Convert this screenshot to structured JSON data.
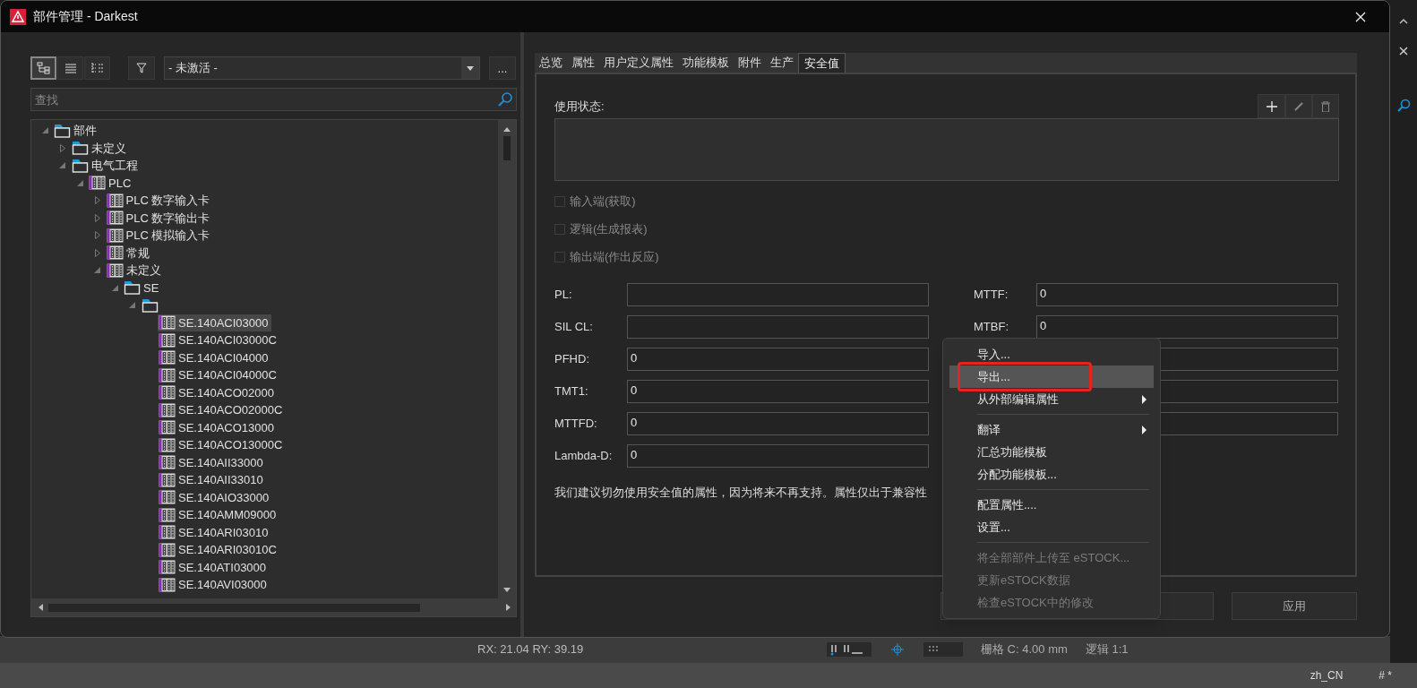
{
  "window": {
    "title": "部件管理 - Darkest"
  },
  "left_toolbar": {
    "view_buttons": [
      {
        "kind": "tree",
        "selected": true
      },
      {
        "kind": "list",
        "selected": false
      },
      {
        "kind": "tree_list",
        "selected": false
      }
    ],
    "filter_value": "- 未激活 -",
    "more_button": "..."
  },
  "search": {
    "placeholder": "查找"
  },
  "tree": [
    {
      "kind": "folder",
      "name": "部件",
      "expanded": true,
      "selected": false,
      "children": [
        {
          "kind": "folder",
          "name": "未定义",
          "expanded": false,
          "selected": false
        },
        {
          "kind": "folder",
          "name": "电气工程",
          "expanded": true,
          "selected": false,
          "children": [
            {
              "kind": "component",
              "name": "PLC",
              "expanded": true,
              "selected": false,
              "children": [
                {
                  "kind": "component",
                  "name": "PLC 数字输入卡",
                  "expanded": false,
                  "selected": false
                },
                {
                  "kind": "component",
                  "name": "PLC 数字输出卡",
                  "expanded": false,
                  "selected": false
                },
                {
                  "kind": "component",
                  "name": "PLC 模拟输入卡",
                  "expanded": false,
                  "selected": false
                },
                {
                  "kind": "component",
                  "name": "常规",
                  "expanded": false,
                  "selected": false
                },
                {
                  "kind": "component",
                  "name": "未定义",
                  "expanded": true,
                  "selected": false,
                  "children": [
                    {
                      "kind": "folder",
                      "name": "SE",
                      "expanded": true,
                      "selected": false,
                      "children": [
                        {
                          "kind": "folder",
                          "expanded": true,
                          "selected": false,
                          "children": [
                            {
                              "kind": "component",
                              "name": "SE.140ACI03000",
                              "selected": true
                            },
                            {
                              "kind": "component",
                              "name": "SE.140ACI03000C",
                              "selected": false
                            },
                            {
                              "kind": "component",
                              "name": "SE.140ACI04000",
                              "selected": false
                            },
                            {
                              "kind": "component",
                              "name": "SE.140ACI04000C",
                              "selected": false
                            },
                            {
                              "kind": "component",
                              "name": "SE.140ACO02000",
                              "selected": false
                            },
                            {
                              "kind": "component",
                              "name": "SE.140ACO02000C",
                              "selected": false
                            },
                            {
                              "kind": "component",
                              "name": "SE.140ACO13000",
                              "selected": false
                            },
                            {
                              "kind": "component",
                              "name": "SE.140ACO13000C",
                              "selected": false
                            },
                            {
                              "kind": "component",
                              "name": "SE.140AII33000",
                              "selected": false
                            },
                            {
                              "kind": "component",
                              "name": "SE.140AII33010",
                              "selected": false
                            },
                            {
                              "kind": "component",
                              "name": "SE.140AIO33000",
                              "selected": false
                            },
                            {
                              "kind": "component",
                              "name": "SE.140AMM09000",
                              "selected": false
                            },
                            {
                              "kind": "component",
                              "name": "SE.140ARI03010",
                              "selected": false
                            },
                            {
                              "kind": "component",
                              "name": "SE.140ARI03010C",
                              "selected": false
                            },
                            {
                              "kind": "component",
                              "name": "SE.140ATI03000",
                              "selected": false
                            },
                            {
                              "kind": "component",
                              "name": "SE.140AVI03000",
                              "selected": false
                            }
                          ]
                        }
                      ]
                    }
                  ]
                }
              ]
            }
          ]
        }
      ]
    }
  ],
  "tabs": [
    {
      "label": "总览",
      "selected": false
    },
    {
      "label": "属性",
      "selected": false
    },
    {
      "label": "用户定义属性",
      "selected": false
    },
    {
      "label": "功能模板",
      "selected": false
    },
    {
      "label": "附件",
      "selected": false
    },
    {
      "label": "生产",
      "selected": false
    },
    {
      "label": "安全值",
      "selected": true
    }
  ],
  "usage_status": {
    "label": "使用状态:"
  },
  "checkboxes": [
    {
      "label": "输入端(获取)",
      "checked": false,
      "disabled": true
    },
    {
      "label": "逻辑(生成报表)",
      "checked": false,
      "disabled": true
    },
    {
      "label": "输出端(作出反应)",
      "checked": false,
      "disabled": true
    }
  ],
  "fields_left": [
    {
      "label": "PL:"
    },
    {
      "label": "SIL CL:"
    },
    {
      "label": "PFHD:",
      "value": "0"
    },
    {
      "label": "TMT1:",
      "value": "0"
    },
    {
      "label": "MTTFD:",
      "value": "0"
    },
    {
      "label": "Lambda-D:",
      "value": "0"
    }
  ],
  "fields_right": [
    {
      "kind": "field",
      "label": "MTTF:",
      "value": "0"
    },
    {
      "kind": "field",
      "label": "MTBF:",
      "value": "0"
    },
    {
      "kind": "covered"
    },
    {
      "kind": "covered"
    },
    {
      "kind": "covered"
    }
  ],
  "note": "我们建议切勿使用安全值的属性，因为将来不再支持。属性仅出于兼容性",
  "buttons": [
    {
      "kind": "covered"
    },
    {
      "kind": "button",
      "label": "应用"
    }
  ],
  "context_menu": [
    {
      "kind": "item",
      "label": "导入...",
      "selected": false,
      "disabled": false
    },
    {
      "kind": "item",
      "label": "导出...",
      "selected": true,
      "disabled": false,
      "marked": true
    },
    {
      "kind": "item",
      "label": "从外部编辑属性",
      "selected": false,
      "disabled": false,
      "submenu": true
    },
    {
      "kind": "separator"
    },
    {
      "kind": "item",
      "label": "翻译",
      "selected": false,
      "disabled": false,
      "submenu": true
    },
    {
      "kind": "item",
      "label": "汇总功能模板",
      "selected": false,
      "disabled": false
    },
    {
      "kind": "item",
      "label": "分配功能模板...",
      "selected": false,
      "disabled": false
    },
    {
      "kind": "separator"
    },
    {
      "kind": "item",
      "label": "配置属性....",
      "selected": false,
      "disabled": false
    },
    {
      "kind": "item",
      "label": "设置...",
      "selected": false,
      "disabled": false
    },
    {
      "kind": "separator"
    },
    {
      "kind": "item",
      "label": "将全部部件上传至 eSTOCK...",
      "selected": false,
      "disabled": true
    },
    {
      "kind": "item",
      "label": "更新eSTOCK数据",
      "selected": false,
      "disabled": true
    },
    {
      "kind": "item",
      "label": "检查eSTOCK中的修改",
      "selected": false,
      "disabled": true
    }
  ],
  "status_bar": {
    "coords": "RX: 21.04 RY: 39.19",
    "grid": "栅格 C: 4.00 mm",
    "logic": "逻辑 1:1",
    "locale": "zh_CN",
    "mode": "# *"
  }
}
